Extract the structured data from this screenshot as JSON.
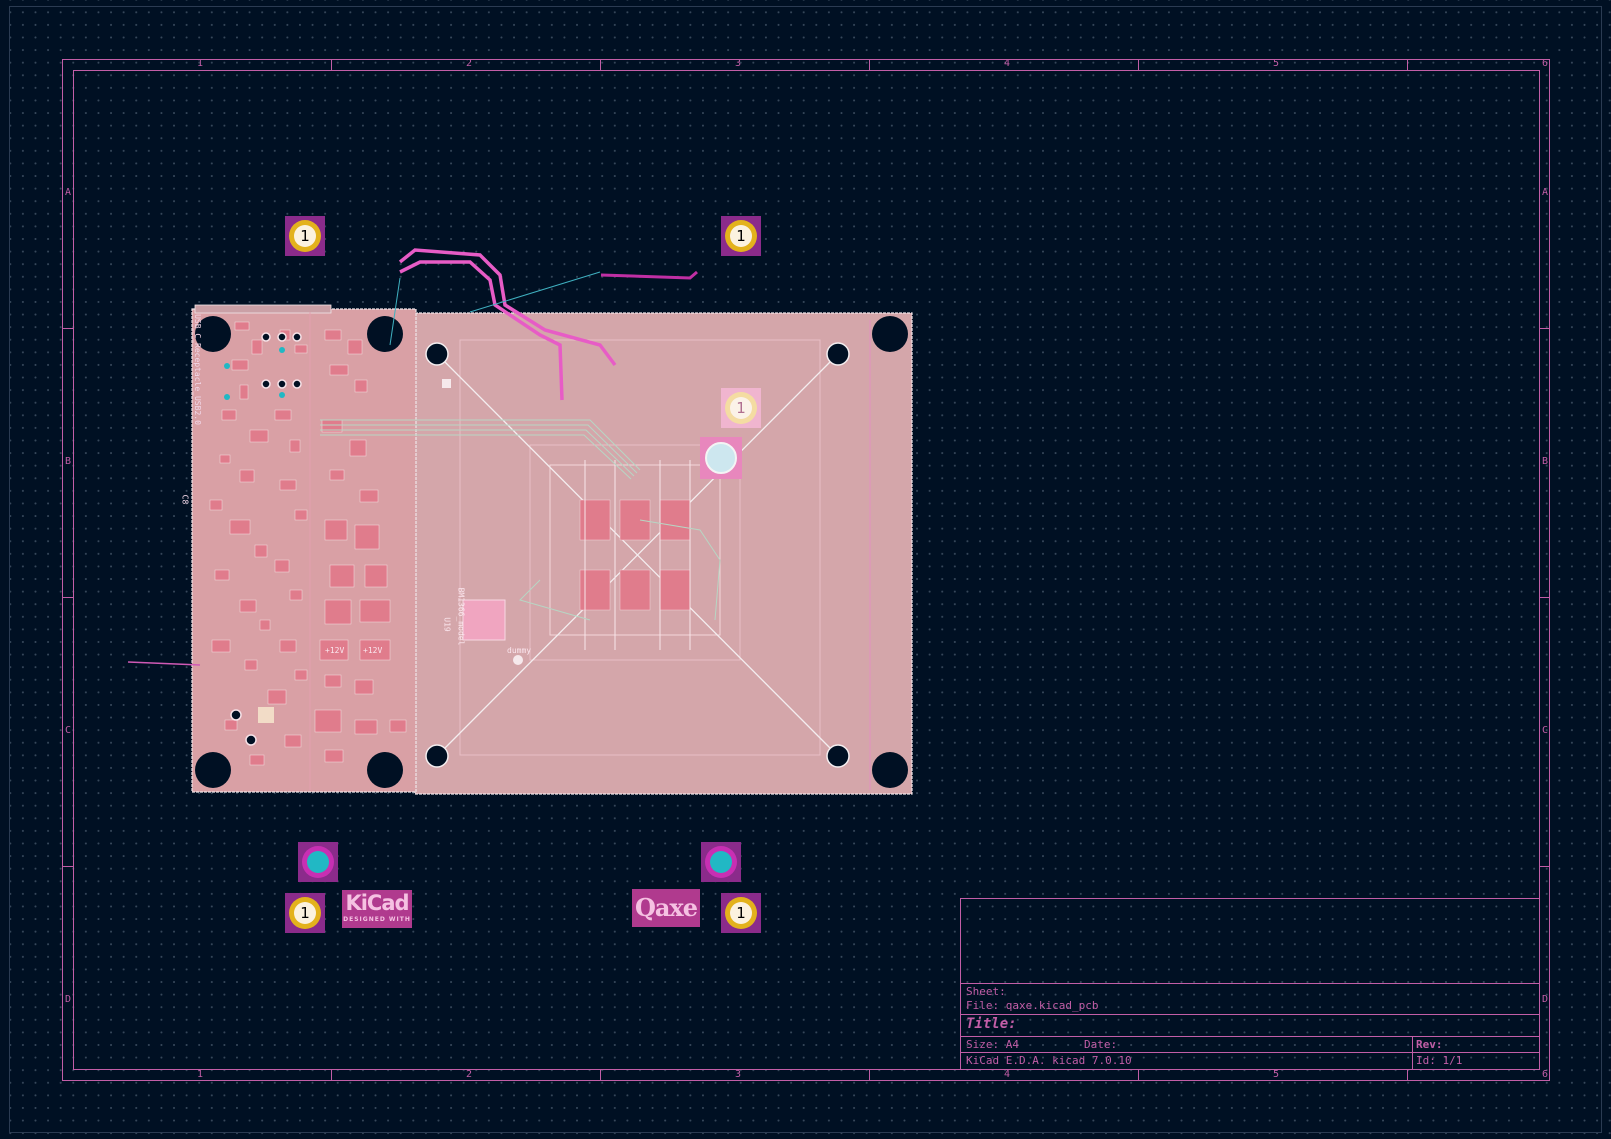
{
  "sheet": {
    "columns": [
      "1",
      "2",
      "3",
      "4",
      "5",
      "6"
    ],
    "rows": [
      "A",
      "B",
      "C",
      "D"
    ]
  },
  "title_block": {
    "sheet": "Sheet:",
    "file": "File: qaxe.kicad_pcb",
    "title": "Title:",
    "size": "Size: A4",
    "date": "Date:",
    "rev": "Rev:",
    "tool": "KiCad E.D.A.  kicad 7.0.10",
    "id": "Id: 1/1"
  },
  "board": {
    "pad_number": "1",
    "silkscreen": {
      "usb_label": "USB_C_Receptacle_USB2.0",
      "ref_c8": "C8",
      "asic_model": "BM1366_model",
      "ref_u19": "U19",
      "dummy": "dummy",
      "v12_a": "+12V",
      "v12_b": "+12V"
    },
    "logos": {
      "kicad_main": "KiCad",
      "kicad_sub": "DESIGNED WITH",
      "qaxe": "Qaxe"
    }
  },
  "colors": {
    "background": "#001023",
    "sheet_frame": "#c25ea7",
    "board_fill": "#d4a6aa",
    "pad_gold": "#e3b21c",
    "via_cyan": "#21b8c4"
  },
  "icons": {
    "mounting_hole": "black-circle-icon",
    "fiducial": "fiducial-pad-icon",
    "via": "plated-via-icon"
  }
}
